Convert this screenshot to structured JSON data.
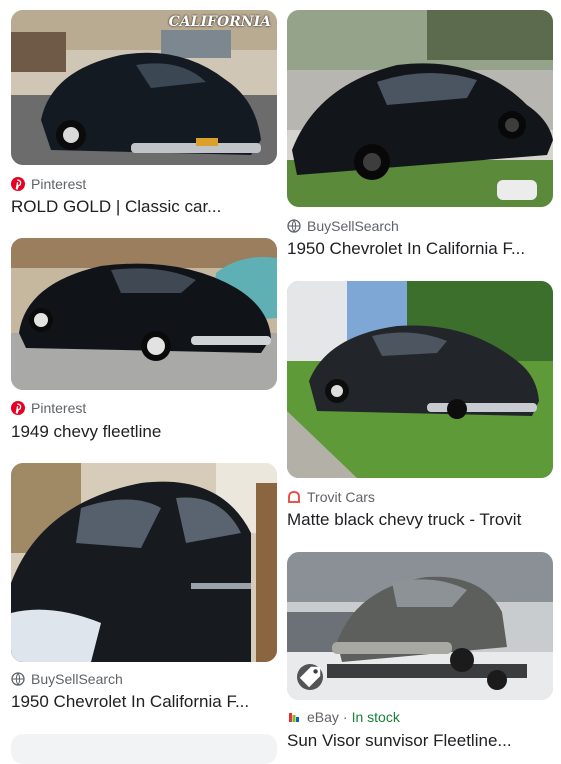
{
  "results": [
    {
      "source": "Pinterest",
      "source_icon": "pinterest-icon",
      "title": "ROLD GOLD | Classic car...",
      "watermark": "CALIFORNIA"
    },
    {
      "source": "BuySellSearch",
      "source_icon": "globe-icon",
      "title": "1950 Chevrolet In California F..."
    },
    {
      "source": "Pinterest",
      "source_icon": "pinterest-icon",
      "title": "1949 chevy fleetline"
    },
    {
      "source": "Trovit Cars",
      "source_icon": "trovit-icon",
      "title": "Matte black chevy truck - Trovit"
    },
    {
      "source": "BuySellSearch",
      "source_icon": "globe-icon",
      "title": "1950 Chevrolet In California F..."
    },
    {
      "source": "eBay",
      "source_icon": "ebay-icon",
      "status": "In stock",
      "title": "Sun Visor sunvisor Fleetline...",
      "badge_icon": "tag-icon"
    }
  ],
  "colors": {
    "text_primary": "#202124",
    "text_secondary": "#5f6368",
    "pinterest_red": "#e60023",
    "trovit_red": "#e8453c",
    "in_stock_green": "#188038"
  }
}
